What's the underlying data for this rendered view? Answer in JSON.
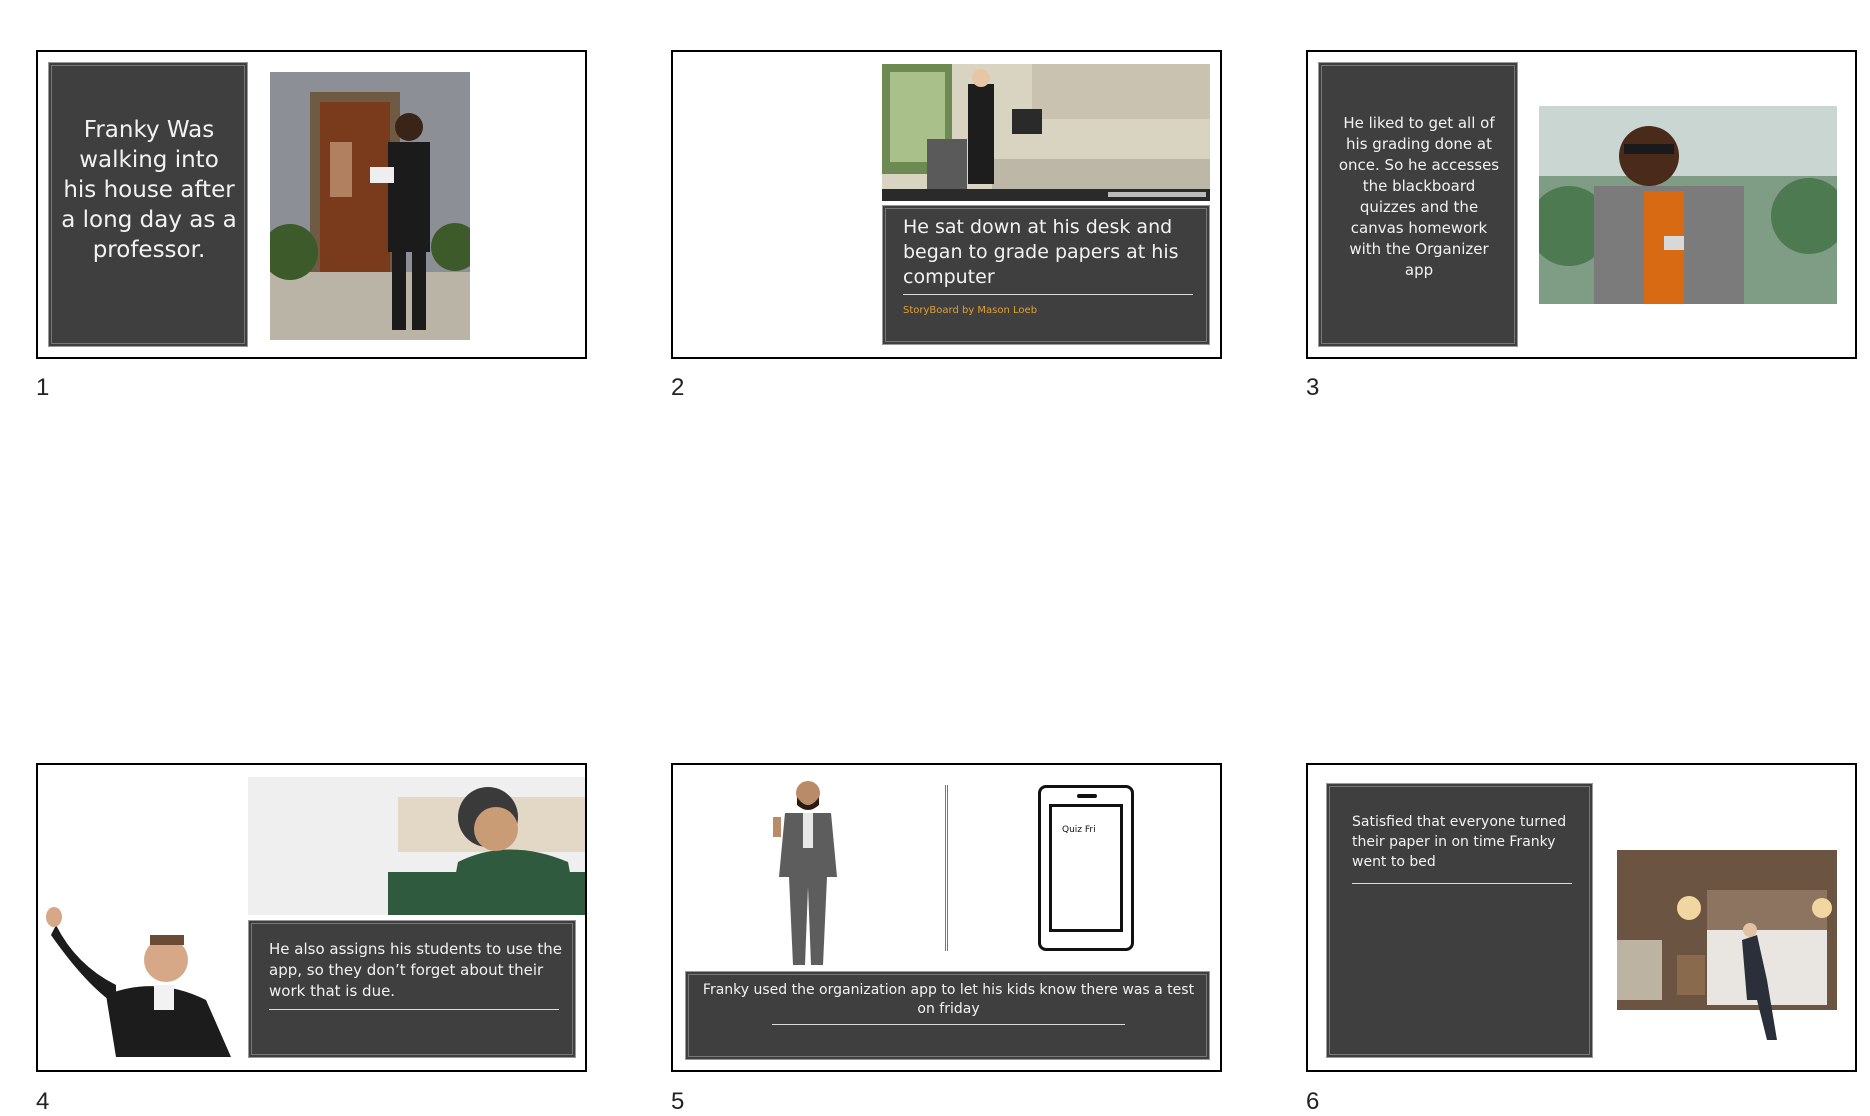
{
  "slides": [
    {
      "number": "1",
      "text": "Franky Was walking into his house after a long day as a professor."
    },
    {
      "number": "2",
      "text": "He sat down at his desk and began to grade papers at his computer",
      "subtitle": "StoryBoard by Mason Loeb"
    },
    {
      "number": "3",
      "text": "He liked to get all of his grading done at once. So he accesses the blackboard quizzes and the canvas homework with the Organizer app"
    },
    {
      "number": "4",
      "text": "He also assigns his students to use the app, so they don’t forget about their work that is due."
    },
    {
      "number": "5",
      "text": "Franky used the organization app to let his kids know there was a test on friday",
      "phone_screen": "Quiz Fri"
    },
    {
      "number": "6",
      "text": "Satisfied that everyone turned their paper in on time Franky went to bed"
    }
  ],
  "colors": {
    "panel": "#3f3f3f",
    "subtitle": "#e0a030",
    "border": "#000000"
  }
}
